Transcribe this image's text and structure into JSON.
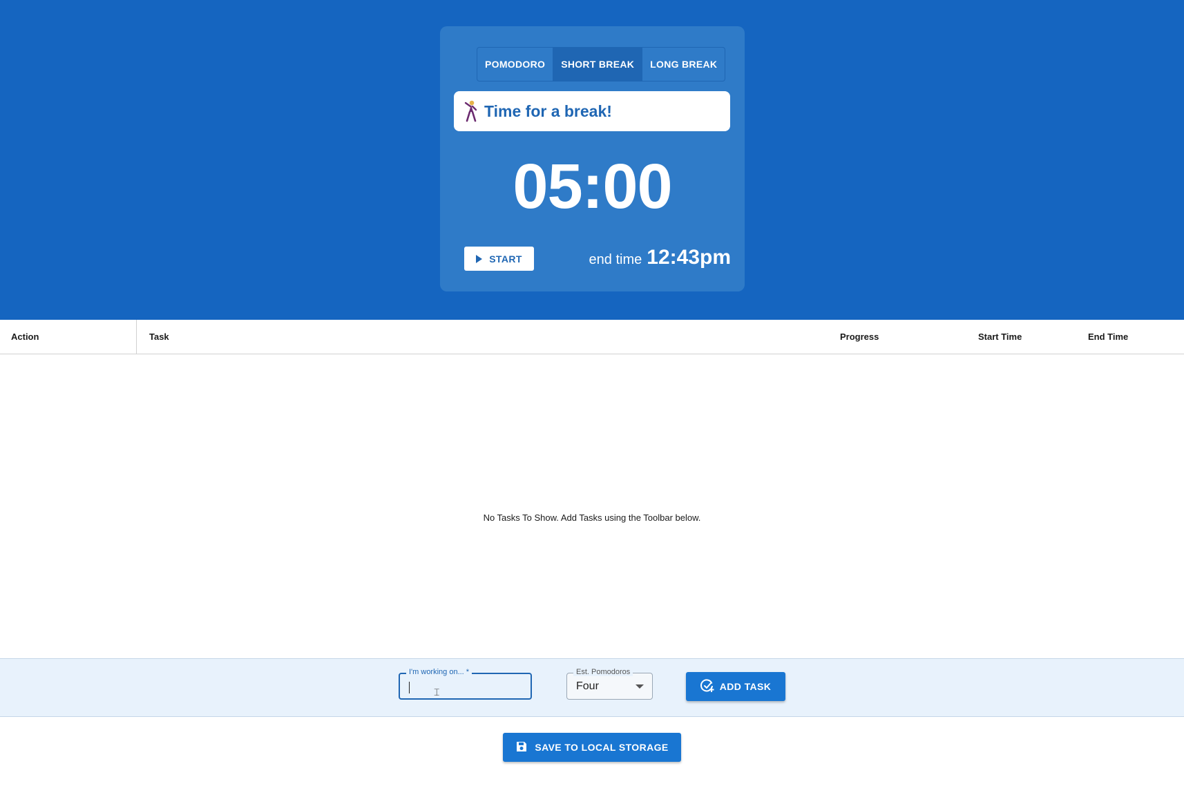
{
  "colors": {
    "hero_bg": "#1565c0",
    "card_bg": "#2f7bc8",
    "accent": "#1976d2"
  },
  "timer": {
    "modes": [
      {
        "label": "POMODORO",
        "active": false
      },
      {
        "label": "SHORT BREAK",
        "active": true
      },
      {
        "label": "LONG BREAK",
        "active": false
      }
    ],
    "message": "Time for a break!",
    "message_icon": "dancer-icon",
    "countdown": "05:00",
    "start_label": "START",
    "start_icon": "play-icon",
    "end_time_label": "end time",
    "end_time_value": "12:43pm"
  },
  "table": {
    "columns": [
      "Action",
      "Task",
      "Progress",
      "Start Time",
      "End Time"
    ],
    "rows": [],
    "empty_message": "No Tasks To Show. Add Tasks using the Toolbar below."
  },
  "toolbar": {
    "task_label": "I'm working on... *",
    "task_value": "",
    "est_label": "Est. Pomodoros",
    "est_value": "Four",
    "add_label": "ADD TASK",
    "add_icon": "add-task-icon"
  },
  "save": {
    "label": "SAVE TO LOCAL STORAGE",
    "icon": "save-icon"
  }
}
